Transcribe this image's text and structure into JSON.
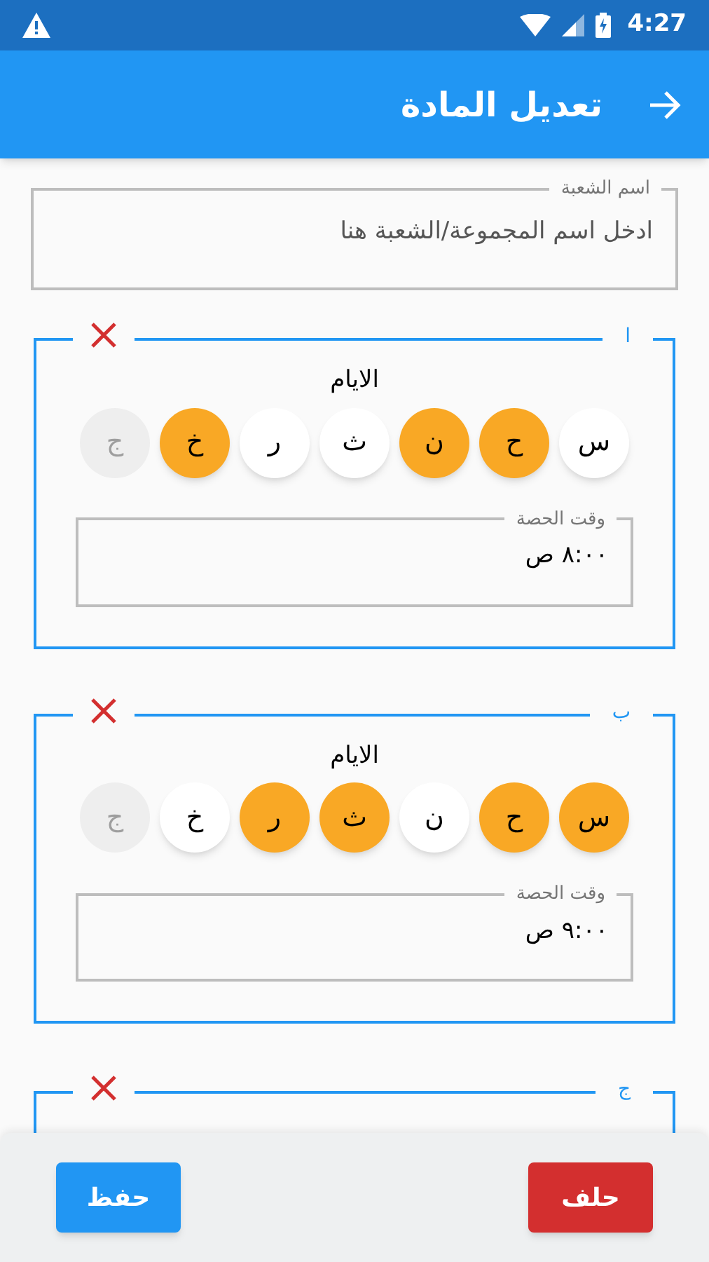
{
  "status_bar": {
    "time": "4:27"
  },
  "app_bar": {
    "title": "تعديل المادة"
  },
  "name_field": {
    "label": "اسم الشعبة",
    "placeholder": "ادخل اسم المجموعة/الشعبة هنا"
  },
  "groups": [
    {
      "label": "ا",
      "days_label": "الايام",
      "days": [
        {
          "label": "س",
          "selected": false,
          "disabled": false
        },
        {
          "label": "ح",
          "selected": true,
          "disabled": false
        },
        {
          "label": "ن",
          "selected": true,
          "disabled": false
        },
        {
          "label": "ث",
          "selected": false,
          "disabled": false
        },
        {
          "label": "ر",
          "selected": false,
          "disabled": false
        },
        {
          "label": "خ",
          "selected": true,
          "disabled": false
        },
        {
          "label": "ج",
          "selected": false,
          "disabled": true
        }
      ],
      "time_field": {
        "label": "وقت الحصة",
        "value": "٨:٠٠ ص"
      }
    },
    {
      "label": "ب",
      "days_label": "الايام",
      "days": [
        {
          "label": "س",
          "selected": true,
          "disabled": false
        },
        {
          "label": "ح",
          "selected": true,
          "disabled": false
        },
        {
          "label": "ن",
          "selected": false,
          "disabled": false
        },
        {
          "label": "ث",
          "selected": true,
          "disabled": false
        },
        {
          "label": "ر",
          "selected": true,
          "disabled": false
        },
        {
          "label": "خ",
          "selected": false,
          "disabled": false
        },
        {
          "label": "ج",
          "selected": false,
          "disabled": true
        }
      ],
      "time_field": {
        "label": "وقت الحصة",
        "value": "٩:٠٠ ص"
      }
    },
    {
      "label": "ج"
    }
  ],
  "buttons": [
    {
      "kind": "delete",
      "label": "حلف"
    },
    {
      "kind": "save",
      "label": "حفظ"
    }
  ]
}
